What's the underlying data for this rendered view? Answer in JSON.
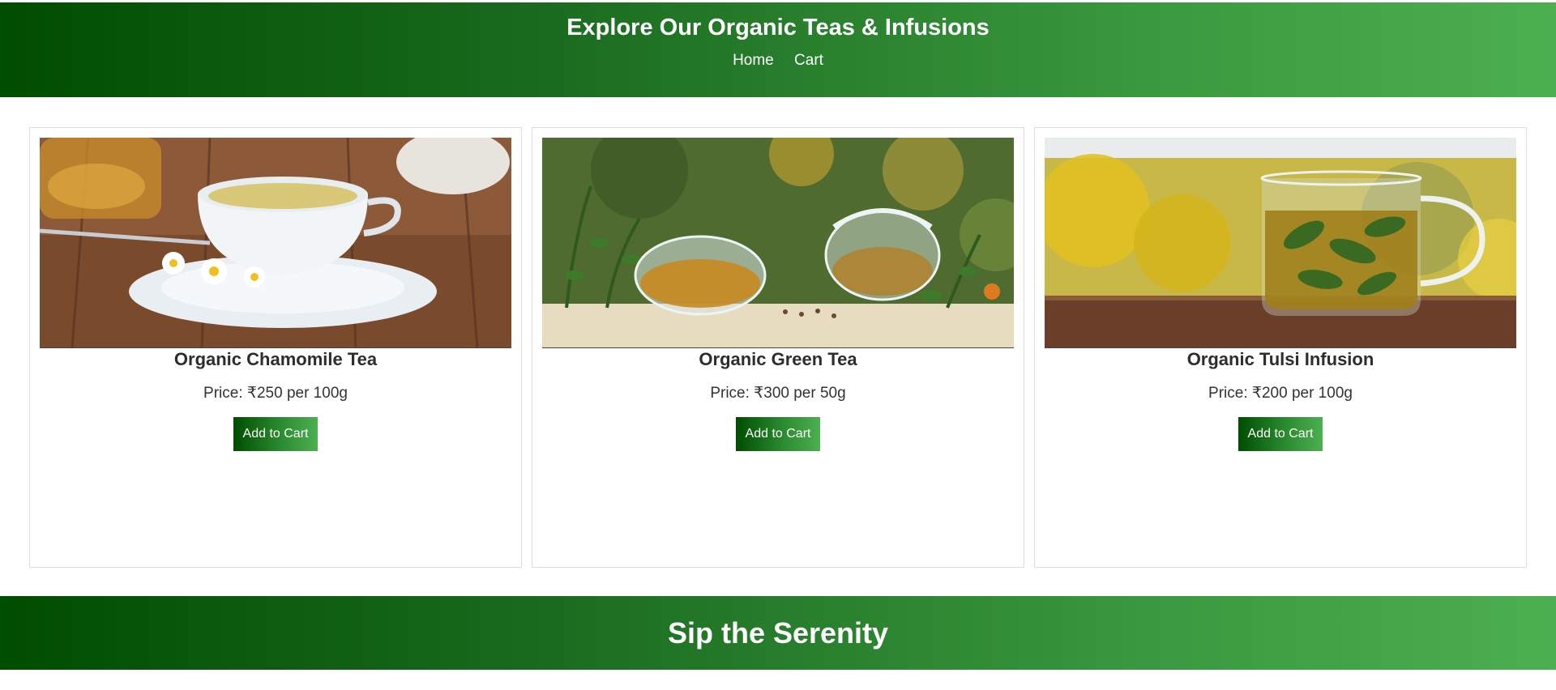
{
  "header": {
    "title": "Explore Our Organic Teas & Infusions",
    "nav": [
      {
        "label": "Home"
      },
      {
        "label": "Cart"
      }
    ]
  },
  "products": [
    {
      "name": "Organic Chamomile Tea",
      "price": "Price: ₹250 per 100g",
      "button": "Add to Cart",
      "image": "chamomile-tea-cup-photo"
    },
    {
      "name": "Organic Green Tea",
      "price": "Price: ₹300 per 50g",
      "button": "Add to Cart",
      "image": "glass-teapot-green-tea-photo"
    },
    {
      "name": "Organic Tulsi Infusion",
      "price": "Price: ₹200 per 100g",
      "button": "Add to Cart",
      "image": "tulsi-infusion-glass-mug-photo"
    }
  ],
  "footer": {
    "tagline": "Sip the Serenity"
  },
  "colors": {
    "brand_dark": "#004d00",
    "brand_light": "#4caf50"
  }
}
